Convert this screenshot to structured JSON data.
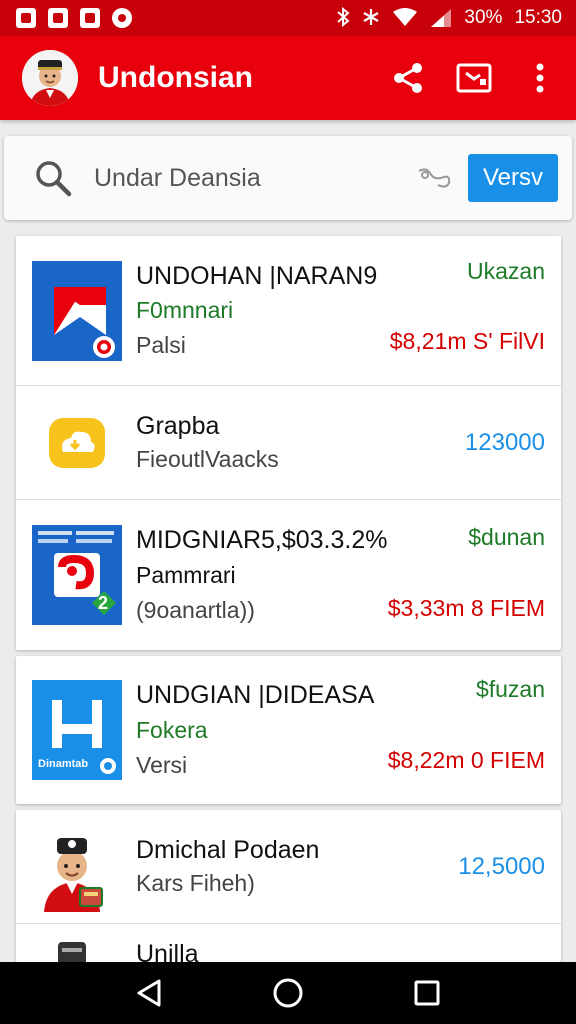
{
  "status_bar": {
    "battery": "30%",
    "time": "15:30"
  },
  "app_bar": {
    "title": "Undonsian"
  },
  "search": {
    "placeholder": "Undar Deansia",
    "button_label": "Versv"
  },
  "items": [
    {
      "title": "UNDOHAN |NARAN9",
      "subtitle_green": "F0mnnari",
      "subtitle_gray": "Palsi",
      "right_top": "Ukazan",
      "right_bottom": "$8,21m S' FilVI",
      "right_mid": ""
    },
    {
      "title": "Grapba",
      "subtitle_green": "",
      "subtitle_gray": "FieoutlVaacks",
      "right_top": "",
      "right_bottom": "",
      "right_mid": "123000"
    },
    {
      "title": "MIDGNIAR5,$03.3.2%",
      "subtitle_green": "Pammrari",
      "subtitle_gray": "(9oanartla))",
      "right_top": "$dunan",
      "right_bottom": "$3,33m 8 FIEM",
      "right_mid": ""
    },
    {
      "title": "UNDGIAN |DIDEASA",
      "subtitle_green": "Fokera",
      "subtitle_gray": "Versi",
      "right_top": "$fuzan",
      "right_bottom": "$8,22m 0 FIEM",
      "right_mid": ""
    },
    {
      "title": "Dmichal Podaen",
      "subtitle_green": "",
      "subtitle_gray": "Kars Fiheh)",
      "right_top": "",
      "right_bottom": "",
      "right_mid": "12,5000"
    },
    {
      "title": "Unilla",
      "subtitle_green": "",
      "subtitle_gray": "",
      "right_top": "",
      "right_bottom": "",
      "right_mid": ""
    }
  ],
  "thumb_labels": {
    "item3_badge": "2",
    "item4_caption": "Dinamtab"
  },
  "colors": {
    "app_bar": "#e8000d",
    "status_bar": "#c8000a",
    "search_button": "#1a8fe8",
    "price_red": "#d40000",
    "label_green": "#1d7a26"
  },
  "icons": {
    "status_left": [
      "gallery-icon",
      "mail-icon",
      "wallet-icon",
      "alarm-icon"
    ],
    "status_right": [
      "bluetooth-icon",
      "asterisk-icon",
      "wifi-icon",
      "signal-icon"
    ],
    "app_bar": [
      "share-icon",
      "cast-icon",
      "more-vert-icon"
    ],
    "nav": [
      "back-icon",
      "home-icon",
      "recents-icon"
    ]
  }
}
